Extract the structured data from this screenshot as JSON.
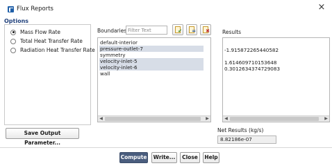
{
  "window": {
    "title": "Flux Reports",
    "close_glyph": "×"
  },
  "options": {
    "title": "Options",
    "items": [
      {
        "label": "Mass Flow Rate",
        "selected": true
      },
      {
        "label": "Total Heat Transfer Rate",
        "selected": false
      },
      {
        "label": "Radiation Heat Transfer Rate",
        "selected": false
      }
    ]
  },
  "boundaries": {
    "label": "Boundaries",
    "filter_placeholder": "Filter Text",
    "toolbar": [
      {
        "icon": "select-all-icon",
        "mark": "✔"
      },
      {
        "icon": "match-icon",
        "mark": "="
      },
      {
        "icon": "deselect-all-icon",
        "mark": "✖"
      }
    ],
    "items": [
      {
        "label": "default-interior",
        "selected": false
      },
      {
        "label": "pressure-outlet-7",
        "selected": true
      },
      {
        "label": "symmetry",
        "selected": false
      },
      {
        "label": "velocity-inlet-5",
        "selected": true
      },
      {
        "label": "velocity-inlet-6",
        "selected": true
      },
      {
        "label": "wall",
        "selected": false
      }
    ]
  },
  "results": {
    "label": "Results",
    "lines": [
      "-1.915872265440582",
      "",
      "1.614609710153648",
      "0.3012634374729083"
    ]
  },
  "net_results": {
    "label": "Net Results (kg/s)",
    "value": "8.82186e-07"
  },
  "buttons": {
    "save_output": "Save Output Parameter...",
    "compute": "Compute",
    "write": "Write...",
    "close": "Close",
    "help": "Help"
  },
  "colors": {
    "accent": "#4a5d7e",
    "selection": "#d7dde7",
    "heading": "#1f3f7a"
  }
}
